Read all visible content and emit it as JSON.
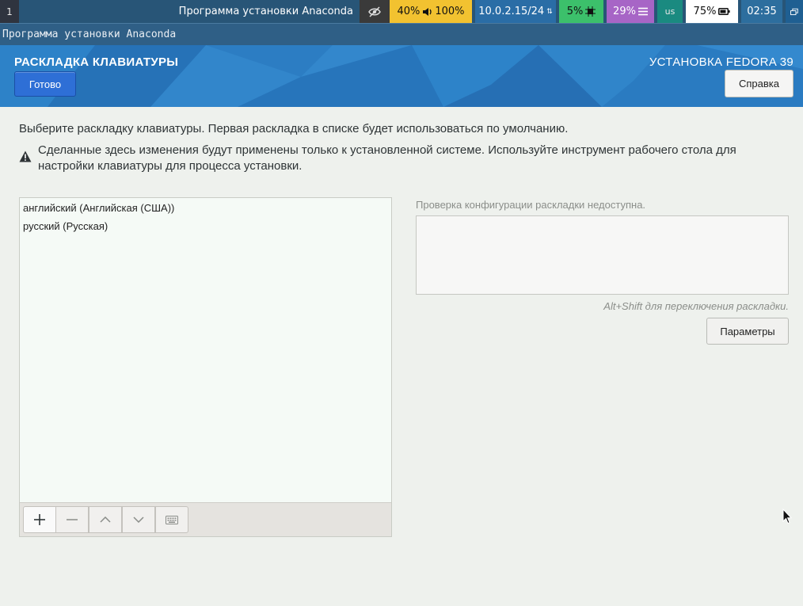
{
  "topbar": {
    "workspace": "1",
    "window_title": "Программа установки Anaconda",
    "volume": {
      "brightness": "40%",
      "volume": "100%"
    },
    "network": "10.0.2.15/24",
    "cpu": "5%",
    "memory": "29%",
    "keyboard_layout": "us",
    "battery": "75%",
    "clock": "02:35"
  },
  "window": {
    "title": "Программа установки Anaconda"
  },
  "header": {
    "spoke_title": "РАСКЛАДКА КЛАВИАТУРЫ",
    "product_title": "УСТАНОВКА FEDORA 39",
    "done_label": "Готово",
    "help_label": "Справка"
  },
  "content": {
    "intro": "Выберите раскладку клавиатуры. Первая раскладка в списке будет использоваться по умолчанию.",
    "warning": "Сделанные здесь изменения будут применены только к установленной системе. Используйте инструмент рабочего стола для настройки клавиатуры для процесса установки.",
    "layouts": [
      "английский (Английская (США))",
      "русский (Русская)"
    ],
    "test_label": "Проверка конфигурации раскладки недоступна.",
    "switch_hint": "Alt+Shift для переключения раскладки.",
    "options_label": "Параметры"
  },
  "icons": {
    "eye": "eye-off-icon",
    "volume": "speaker-icon",
    "cpu": "chip-icon",
    "memory": "menu-lines-icon",
    "battery": "battery-icon",
    "windows": "window-switch-icon",
    "warning": "warning-triangle-icon",
    "add": "plus-icon",
    "remove": "minus-icon",
    "up": "chevron-up-icon",
    "down": "chevron-down-icon",
    "preview": "keyboard-icon"
  },
  "colors": {
    "accent_blue": "#2e6fd6",
    "header_blue": "#2a7ac0",
    "volume_block": "#f2c230",
    "cpu_block": "#3cc06b",
    "memory_block": "#a765c6"
  }
}
